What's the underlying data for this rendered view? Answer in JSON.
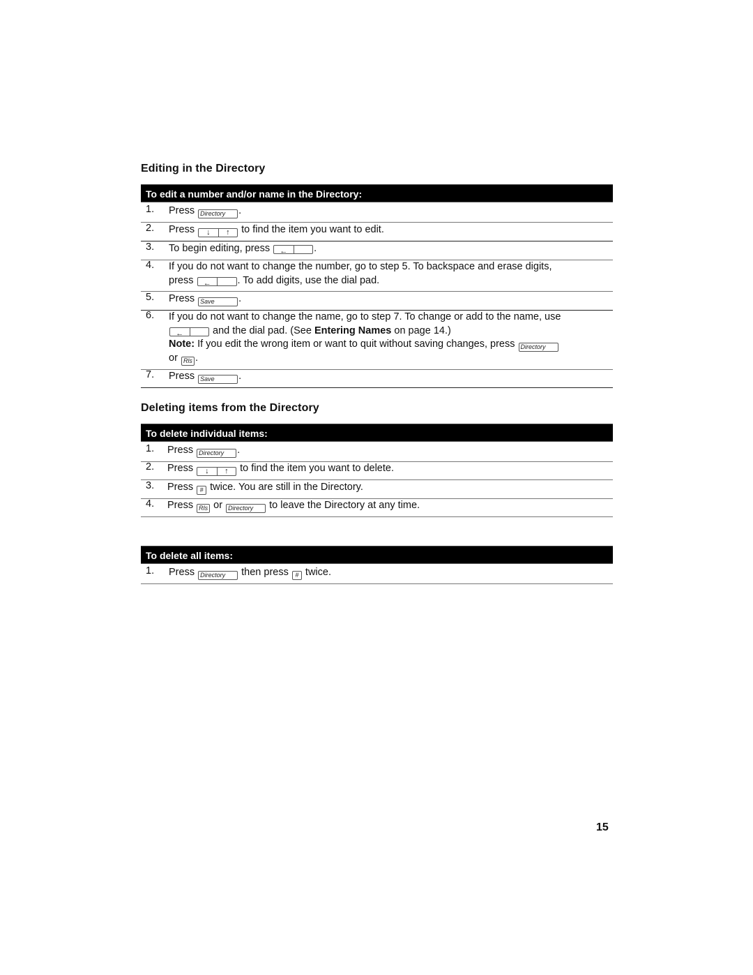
{
  "section1": {
    "title": "Editing in the Directory",
    "bar": "To edit a number and/or name in the Directory:",
    "steps": [
      {
        "num": "1.",
        "before": "Press",
        "key": "Directory",
        "after": "."
      },
      {
        "num": "2.",
        "before": "Press",
        "key_left": "↓",
        "key_right": "↑",
        "after": "to find the item you want to edit."
      },
      {
        "num": "3.",
        "before": "To begin editing, press",
        "key_left": "←",
        "key_right": "",
        "after": "."
      },
      {
        "num": "4.",
        "line1": "If you do not want to change the number, go to step 5. To backspace and erase digits,",
        "before": "press",
        "key_left": "←",
        "key_right": "",
        "after": ". To add digits, use the dial pad."
      },
      {
        "num": "5.",
        "before": "Press",
        "key": "Save",
        "after": "."
      },
      {
        "num": "6.",
        "line1": "If you do not want to change the name, go to step 7. To change or add to the name, use",
        "key_left": "←",
        "key_right": "",
        "mid": "and the dial pad. (See",
        "bold": "Entering Names",
        "after": "on page 14.)",
        "note_label": "Note:",
        "note_text": "If you edit the wrong item or want to quit without saving changes, press",
        "note_key": "Directory",
        "note_or": "or",
        "note_key2": "Rls",
        "note_end": "."
      },
      {
        "num": "7.",
        "before": "Press",
        "key": "Save",
        "after": "."
      }
    ]
  },
  "section2": {
    "title": "Deleting items from the Directory",
    "bar": "To delete individual items:",
    "steps": [
      {
        "num": "1.",
        "before": "Press",
        "key": "Directory",
        "after": "."
      },
      {
        "num": "2.",
        "before": "Press",
        "key_left": "↓",
        "key_right": "↑",
        "after": "to find the item you want to delete."
      },
      {
        "num": "3.",
        "before": "Press",
        "key": "#",
        "after": "twice. You are still in the Directory."
      },
      {
        "num": "4.",
        "before": "Press",
        "key": "Rls",
        "mid": "or",
        "key2": "Directory",
        "after": "to leave the Directory at any time."
      }
    ]
  },
  "section3": {
    "bar": "To delete all items:",
    "steps": [
      {
        "num": "1.",
        "before": "Press",
        "key": "Directory",
        "mid": "then press",
        "key2": "#",
        "after": "twice."
      }
    ]
  },
  "page_number": "15"
}
